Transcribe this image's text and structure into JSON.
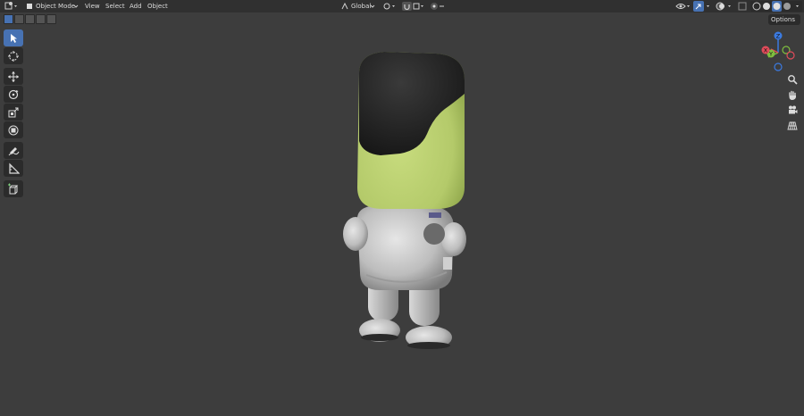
{
  "header": {
    "mode_label": "Object Mode",
    "menu": [
      "View",
      "Select",
      "Add",
      "Object"
    ],
    "transform_orientation": "Global"
  },
  "viewport": {
    "options_label": "Options",
    "gizmo_axes": {
      "z": "Z",
      "y": "Y",
      "x": "X"
    },
    "background_color": "#3d3d3d"
  },
  "toolbar": {
    "tools": [
      "select-box",
      "cursor",
      "move",
      "rotate",
      "scale",
      "transform",
      "annotate",
      "measure",
      "add-cube"
    ],
    "active_tool": "select-box"
  },
  "colors": {
    "accent": "#4772b3",
    "header_bg": "#303030",
    "character_head": "#b8cf6f",
    "character_body": "#c8c8c8"
  }
}
